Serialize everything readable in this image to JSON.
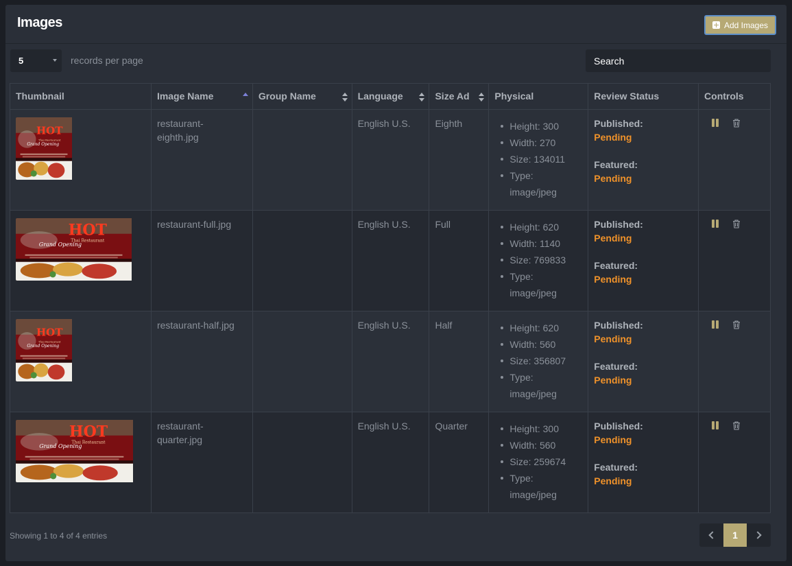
{
  "header": {
    "title": "Images",
    "add_button_label": "Add Images"
  },
  "toolbar": {
    "per_page_value": "5",
    "per_page_label": "records per page",
    "search_placeholder": "Search"
  },
  "table": {
    "columns": [
      "Thumbnail",
      "Image Name",
      "Group Name",
      "Language",
      "Size Ad",
      "Physical",
      "Review Status",
      "Controls"
    ],
    "rows": [
      {
        "name": "restaurant-eighth.jpg",
        "group": "",
        "language": "English U.S.",
        "size_ad": "Eighth",
        "physical": [
          "Height: 300",
          "Width: 270",
          "Size: 134011",
          "Type: image/jpeg"
        ],
        "published_label": "Published:",
        "published": "Pending",
        "featured_label": "Featured:",
        "featured": "Pending"
      },
      {
        "name": "restaurant-full.jpg",
        "group": "",
        "language": "English U.S.",
        "size_ad": "Full",
        "physical": [
          "Height: 620",
          "Width: 1140",
          "Size: 769833",
          "Type: image/jpeg"
        ],
        "published_label": "Published:",
        "published": "Pending",
        "featured_label": "Featured:",
        "featured": "Pending"
      },
      {
        "name": "restaurant-half.jpg",
        "group": "",
        "language": "English U.S.",
        "size_ad": "Half",
        "physical": [
          "Height: 620",
          "Width: 560",
          "Size: 356807",
          "Type: image/jpeg"
        ],
        "published_label": "Published:",
        "published": "Pending",
        "featured_label": "Featured:",
        "featured": "Pending"
      },
      {
        "name": "restaurant-quarter.jpg",
        "group": "",
        "language": "English U.S.",
        "size_ad": "Quarter",
        "physical": [
          "Height: 300",
          "Width: 560",
          "Size: 259674",
          "Type: image/jpeg"
        ],
        "published_label": "Published:",
        "published": "Pending",
        "featured_label": "Featured:",
        "featured": "Pending"
      }
    ]
  },
  "thumbnail": {
    "headline": "HOT",
    "subtitle": "Thai Restaurant",
    "tagline": "Grand Opening"
  },
  "footer": {
    "info": "Showing 1 to 4 of 4 entries",
    "current_page": "1"
  },
  "colors": {
    "accent": "#b6a974",
    "status_pending": "#f0922a",
    "sort_active": "#7b80d6"
  },
  "icons": {
    "add": "plus-square-icon",
    "pause": "pause-icon",
    "delete": "trash-icon",
    "prev": "chevron-left-icon",
    "next": "chevron-right-icon"
  }
}
